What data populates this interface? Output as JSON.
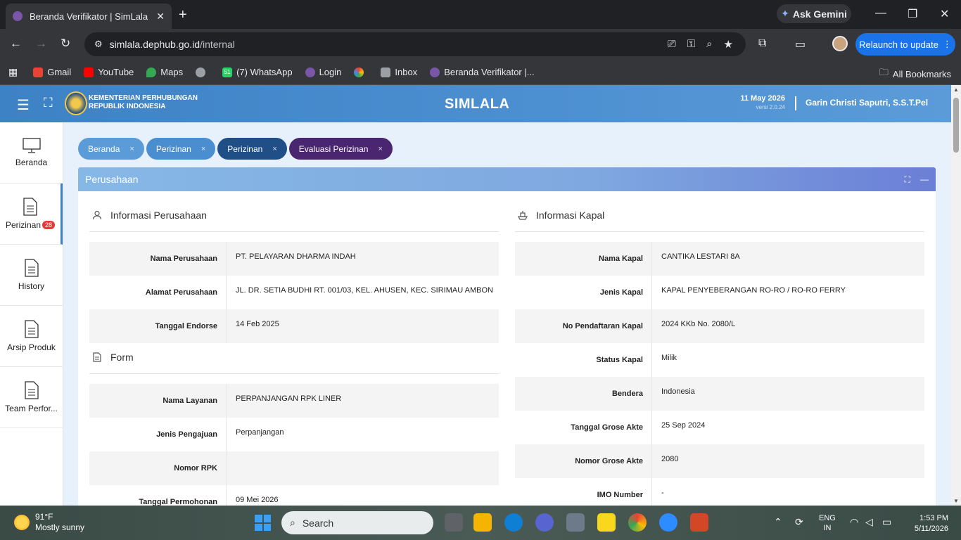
{
  "browser": {
    "tab_title": "Beranda Verifikator | SimLala",
    "new_tab": "+",
    "gemini_label": "Ask Gemini",
    "url_host": "simlala.dephub.go.id",
    "url_path": "/internal",
    "relaunch_label": "Relaunch to update",
    "bookmarks": [
      "Gmail",
      "YouTube",
      "Maps",
      "(7) WhatsApp",
      "Login",
      "Inbox",
      "Beranda Verifikator |..."
    ],
    "whatsapp_count": "51",
    "all_bookmarks": "All Bookmarks"
  },
  "header": {
    "ministry_line1": "KEMENTERIAN PERHUBUNGAN",
    "ministry_line2": "REPUBLIK INDONESIA",
    "app_name": "SIMLALA",
    "date": "11 May 2026",
    "version": "versi 2.0.24",
    "user": "Garin Christi Saputri, S.S.T.Pel"
  },
  "sidebar": {
    "items": [
      {
        "label": "Beranda"
      },
      {
        "label": "Perizinan",
        "badge": "28"
      },
      {
        "label": "History"
      },
      {
        "label": "Arsip Produk"
      },
      {
        "label": "Team Perfor..."
      }
    ]
  },
  "breadcrumbs": [
    "Beranda",
    "Perizinan",
    "Perizinan",
    "Evaluasi Perizinan"
  ],
  "panel": {
    "title": "Perusahaan",
    "company_section": {
      "title": "Informasi Perusahaan",
      "rows": [
        {
          "label": "Nama Perusahaan",
          "value": "PT. PELAYARAN DHARMA INDAH"
        },
        {
          "label": "Alamat Perusahaan",
          "value": "JL. DR. SETIA BUDHI RT. 001/03, KEL. AHUSEN, KEC. SIRIMAU AMBON"
        },
        {
          "label": "Tanggal Endorse",
          "value": "14 Feb 2025"
        }
      ]
    },
    "form_section": {
      "title": "Form",
      "rows": [
        {
          "label": "Nama Layanan",
          "value": "PERPANJANGAN RPK LINER"
        },
        {
          "label": "Jenis Pengajuan",
          "value": "Perpanjangan"
        },
        {
          "label": "Nomor RPK",
          "value": ""
        },
        {
          "label": "Tanggal Permohonan",
          "value": "09 Mei 2026"
        }
      ]
    },
    "ship_section": {
      "title": "Informasi Kapal",
      "rows": [
        {
          "label": "Nama Kapal",
          "value": "CANTIKA LESTARI 8A"
        },
        {
          "label": "Jenis Kapal",
          "value": "KAPAL PENYEBERANGAN RO-RO / RO-RO FERRY"
        },
        {
          "label": "No Pendaftaran Kapal",
          "value": "2024 KKb No. 2080/L"
        },
        {
          "label": "Status Kapal",
          "value": "Milik"
        },
        {
          "label": "Bendera",
          "value": "Indonesia"
        },
        {
          "label": "Tanggal Grose Akte",
          "value": "25 Sep 2024"
        },
        {
          "label": "Nomor Grose Akte",
          "value": "2080"
        },
        {
          "label": "IMO Number",
          "value": "-"
        }
      ]
    }
  },
  "taskbar": {
    "temp": "91°F",
    "weather": "Mostly sunny",
    "search": "Search",
    "lang1": "ENG",
    "lang2": "IN",
    "time": "1:53 PM",
    "date": "5/11/2026"
  }
}
